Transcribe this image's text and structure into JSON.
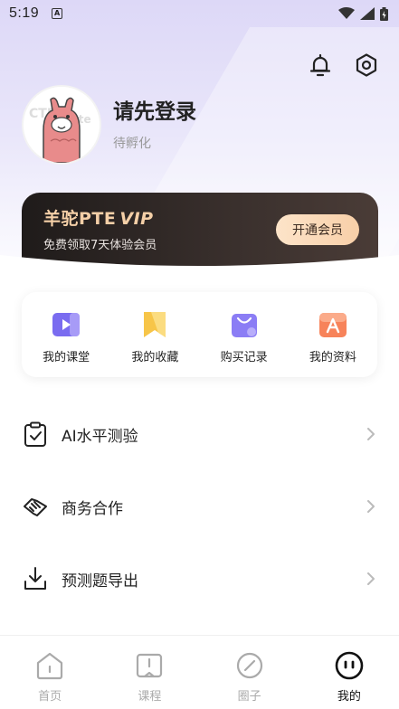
{
  "status_bar": {
    "time": "5:19",
    "badge": "A"
  },
  "header": {
    "icons": [
      "bell-icon",
      "settings-icon"
    ]
  },
  "profile": {
    "name": "请先登录",
    "status": "待孵化"
  },
  "vip": {
    "title": "羊驼PTE",
    "tag": "VIP",
    "subtitle": "免费领取7天体验会员",
    "button": "开通会员"
  },
  "shortcuts": [
    {
      "label": "我的课堂",
      "icon": "play-icon",
      "color": "#7a6cf0"
    },
    {
      "label": "我的收藏",
      "icon": "bookmark-icon",
      "color": "#f7c548"
    },
    {
      "label": "购买记录",
      "icon": "shopping-bag-icon",
      "color": "#8b7df5"
    },
    {
      "label": "我的资料",
      "icon": "document-a-icon",
      "color": "#f7835a"
    }
  ],
  "menu": [
    {
      "label": "AI水平测验",
      "icon": "clipboard-check-icon"
    },
    {
      "label": "商务合作",
      "icon": "handshake-icon"
    },
    {
      "label": "预测题导出",
      "icon": "download-icon"
    }
  ],
  "tabs": [
    {
      "label": "首页",
      "icon": "home-icon",
      "active": false
    },
    {
      "label": "课程",
      "icon": "book-icon",
      "active": false
    },
    {
      "label": "圈子",
      "icon": "compass-icon",
      "active": false
    },
    {
      "label": "我的",
      "icon": "profile-face-icon",
      "active": true
    }
  ]
}
